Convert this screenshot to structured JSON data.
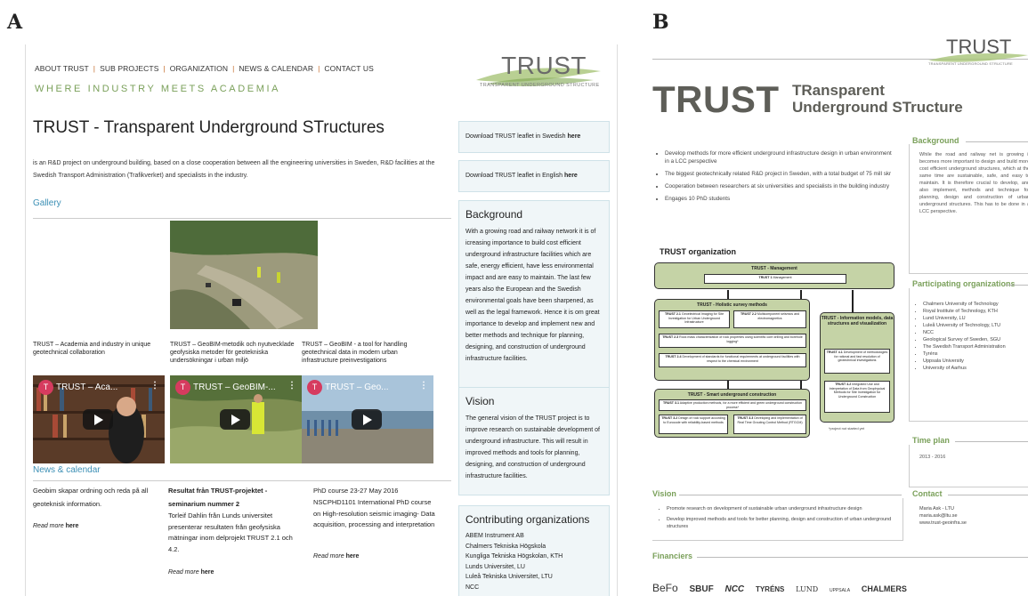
{
  "panel_labels": {
    "a": "A",
    "b": "B"
  },
  "site": {
    "nav": [
      "ABOUT TRUST",
      "SUB PROJECTS",
      "ORGANIZATION",
      "NEWS & CALENDAR",
      "CONTACT US"
    ],
    "nav_sep": "|",
    "tagline": "WHERE INDUSTRY MEETS ACADEMIA",
    "logo_title": "TRUST",
    "logo_sub": "TRANSPARENT UNDERGROUND STRUCTURE",
    "page_title": "TRUST - Transparent Underground STructures",
    "intro": "is an R&D project on underground building, based on a close cooperation between all the engineering universities in Sweden, R&D facilities at the Swedish Transport Administration (Trafikverket)  and specialists in the industry.",
    "gallery_heading": "Gallery",
    "captions": [
      "TRUST – Academia and industry in unique geotechnical collaboration",
      "TRUST – GeoBIM-metodik och nyutvecklade geofysiska metoder för geotekniska undersökningar i urban miljö",
      "TRUST – GeoBIM - a tool for handling geotechnical data in modern urban infrastructure preinvestigations"
    ],
    "videos": [
      {
        "avatar": "T",
        "title": "TRUST – Aca...",
        "menu": "⋮"
      },
      {
        "avatar": "T",
        "title": "TRUST – GeoBIM-...",
        "menu": "⋮"
      },
      {
        "avatar": "T",
        "title": "TRUST – Geo...",
        "menu": "⋮"
      }
    ],
    "news_heading": "News & calendar",
    "news": [
      {
        "title": "Geobim skapar ordning och reda på all geoteknisk information.",
        "body": ""
      },
      {
        "title": "Resultat från TRUST-projektet - seminarium nummer 2",
        "body": "Torleif Dahlin från Lunds universitet presenterar resultaten från geofysiska mätningar inom delprojekt TRUST 2.1 och 4.2."
      },
      {
        "title": "PhD course 23-27 May 2016",
        "body": "NSCPHD1101 International PhD course on High-resolution seismic imaging- Data acquisition, processing and interpretation"
      }
    ],
    "read_more": "Read more",
    "read_more_link": "here",
    "download_sv": "Download TRUST leaflet in Swedish",
    "download_en": "Download TRUST leaflet in English",
    "download_link": "here",
    "background_heading": "Background",
    "background_text": "With a growing road and railway network it is of icreasing importance to build cost efficient underground infrastructure facilities which are safe, energy efficient, have less environmental impact and are easy to maintain. The last few years also the European and the Swedish environmental goals have been sharpened, as well as the legal framework. Hence it is om great importance to develop and implement new and better methods and technique for planning, designing, and construction of underground infrastructure facilities.",
    "vision_heading": "Vision",
    "vision_text": "The general vision of the TRUST project is to improve research on sustainable development of underground infrastructure. This will result in improved methods and tools for planning, designing, and construction of underground infrastructure facilities.",
    "contrib_heading": "Contributing organizations",
    "contrib": [
      "ABEM Instrument AB",
      "Chalmers  Tekniska Högskola",
      "Kungliga Tekniska Högskolan, KTH",
      "Lunds Universitet, LU",
      "Luleå Tekniska Universitet, LTU",
      "NCC"
    ]
  },
  "poster": {
    "logo_title": "TRUST",
    "logo_sub": "TRANSPARENT UNDERGROUND STRUCTURE",
    "big_title": "TRUST",
    "sub_line1": "TRansparent",
    "sub_line2": "Underground STructure",
    "bullets": [
      "Develop methods for more efficient underground infrastructure design in urban environment in a LCC perspective",
      "The biggest  geotechnically related R&D project in Sweden, with a total budget of 75 mill skr",
      "Cooperation between researchers at six universities and specialists in the building industry",
      "Engages 10 PhD students"
    ],
    "background_heading": "Background",
    "background_text": "While the road and railway net is growing it becomes more important to design and build more cost efficient underground structures, which at the same time are sustainable, safe, and easy to maintain. It is therefore crucial to develop, and also implement, methods and technique for planning, design and construction of urban underground structures. This has to be done in a LCC perspective.",
    "participating_heading": "Participating organizations",
    "participating": [
      "Chalmers University of Technology",
      "Royal Institute of Technology, KTH",
      "Lund University, LU",
      "Luleå University of Technology, LTU",
      "NCC",
      "Geological Survey of Sweden, SGU",
      "The Swedish Transport Administration",
      "Tyréns",
      "Uppsala University",
      "University of Aarhus"
    ],
    "org_title": "TRUST organization",
    "org": {
      "management": "TRUST - Management",
      "t1": "TRUST 1",
      "t1_desc": "Management",
      "holistic": "TRUST - Holistic survey methods",
      "t21": "TRUST 2.1",
      "t21_desc": "Geoelectrical Imaging for Site Investigation for Urban Underground Infrastructure",
      "t22": "TRUST 2.2",
      "t22_desc": "Multicomponent seismics and electromagnetics",
      "t23": "TRUST 2.3",
      "t23_desc": "Rock mass characterization of rock properties using scientific core drilling and borehole logging*",
      "t24": "TRUST 2.4",
      "t24_desc": "Development of standards for functional requirements at underground facilities with respect to the chemical environment",
      "info": "TRUST - Information models, data structures and visualization",
      "t41": "TRUST 4.1",
      "t41_desc": "Development of methodologies for rational and fast resolution of geotechnical investigations",
      "t42": "TRUST 4.2",
      "t42_desc": "Integrated Use and Interpretation of Data from Geophysical Methods for Site Investigation for Underground Construction",
      "smart": "TRUST - Smart underground construction",
      "t31": "TRUST 3.1",
      "t31_desc": "Adaptive production methods, for a more efficient and green underground construction process*",
      "t32": "TRUST 3.2",
      "t32_desc": "Design of rock support according to Eurocode with reliability-based methods",
      "t33": "TRUST 3.3",
      "t33_desc": "Developing and implementation of Real Time Grouting Control Method (RTGCM)",
      "note": "*project not started yet"
    },
    "timeplan_heading": "Time plan",
    "timeplan_text": "2013 - 2016",
    "vision_heading": "Vision",
    "vision_bullets": [
      "Promote research on development of sustainable urban underground infrastructure design",
      "Develop improved methods and tools for better planning, design and construction of urban underground structures"
    ],
    "contact_heading": "Contact",
    "contact": [
      "Maria Ask - LTU",
      "maria.ask@ltu.se",
      "www.trust-geoinfra.se"
    ],
    "financiers_heading": "Financiers",
    "financiers": [
      "BeFo",
      "SBUF",
      "NCC",
      "TYRÉNS",
      "LUND",
      "UPPSALA",
      "CHALMERS"
    ]
  }
}
